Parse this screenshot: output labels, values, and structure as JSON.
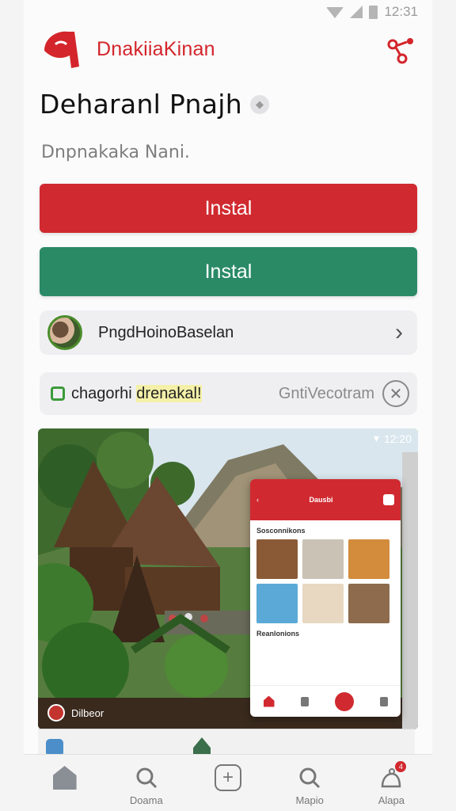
{
  "status_bar": {
    "time": "12:31"
  },
  "header": {
    "brand": "DnakiiaKinan",
    "brand_color": "#d3252b"
  },
  "app": {
    "title": "Deharanl Pnajh",
    "subtitle": "Dnpnakaka Nani.",
    "verified_icon": "shield-icon"
  },
  "buttons": {
    "install_primary": "Instal",
    "install_secondary": "Instal",
    "primary_color": "#d02a30",
    "secondary_color": "#2a8a66"
  },
  "developer": {
    "name": "PngdHoinoBaselan"
  },
  "info": {
    "label_start": "chagorhi ",
    "label_highlight": "drenakal!",
    "right_text": "GntiVecotram"
  },
  "hero": {
    "status_time": "12:20",
    "caption": "Dilbeor",
    "phone": {
      "title": "Dausbi",
      "section_one": "Sosconnikons",
      "section_two": "Reanlonions"
    }
  },
  "bottom_nav": [
    {
      "label": "",
      "icon": "home-icon"
    },
    {
      "label": "Doama",
      "icon": "search-icon"
    },
    {
      "label": "",
      "icon": "plus-square-icon"
    },
    {
      "label": "Mapio",
      "icon": "search-icon"
    },
    {
      "label": "Alapa",
      "icon": "notification-icon",
      "badge": "4"
    }
  ]
}
